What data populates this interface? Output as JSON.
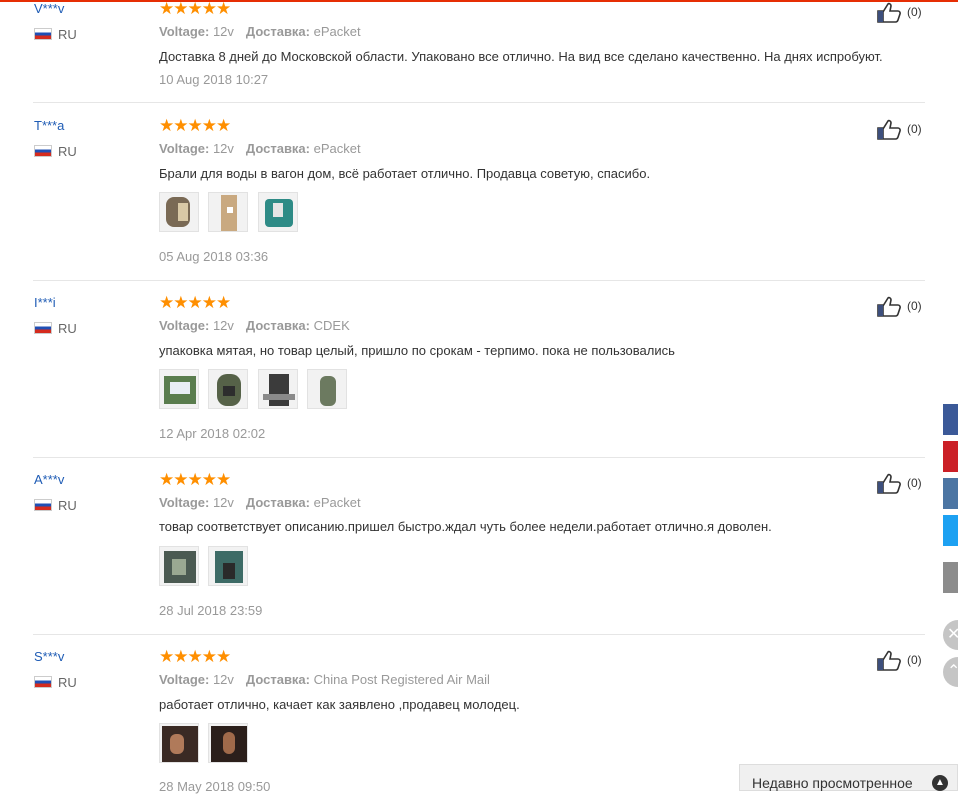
{
  "labels": {
    "voltage": "Voltage:",
    "delivery": "Доставка:",
    "country": "RU"
  },
  "reviews": [
    {
      "user": "V***v",
      "country": "RU",
      "voltage": "12v",
      "delivery": "ePacket",
      "text": "Доставка 8 дней до Московской области. Упаковано все отлично. На вид все сделано качественно. На днях испробуют.",
      "date": "10 Aug 2018 10:27",
      "likes": "(0)",
      "rating": 5
    },
    {
      "user": "T***a",
      "country": "RU",
      "voltage": "12v",
      "delivery": "ePacket",
      "text": "Брали для воды в вагон дом, всё работает отлично. Продавца советую, спасибо.",
      "date": "05 Aug 2018 03:36",
      "likes": "(0)",
      "rating": 5
    },
    {
      "user": "I***i",
      "country": "RU",
      "voltage": "12v",
      "delivery": "CDEK",
      "text": "упаковка мятая, но товар целый, пришло по срокам - терпимо. пока не пользовались",
      "date": "12 Apr 2018 02:02",
      "likes": "(0)",
      "rating": 5
    },
    {
      "user": "A***v",
      "country": "RU",
      "voltage": "12v",
      "delivery": "ePacket",
      "text": "товар соответствует описанию.пришел быстро.ждал чуть более недели.работает отлично.я доволен.",
      "date": "28 Jul 2018 23:59",
      "likes": "(0)",
      "rating": 5
    },
    {
      "user": "S***v",
      "country": "RU",
      "voltage": "12v",
      "delivery": "China Post Registered Air Mail",
      "text": "работает отлично, качает как заявлено ,продавец молодец.",
      "date": "28 May 2018 09:50",
      "likes": "(0)",
      "rating": 5
    }
  ],
  "stars": "★★★★★",
  "recently_viewed": {
    "label": "Недавно просмотренное"
  },
  "share_icons": [
    "facebook-icon",
    "pinterest-icon",
    "vk-icon",
    "twitter-icon",
    "more-icon"
  ],
  "colors": {
    "accent": "#e62e04",
    "star": "#ff8f00",
    "link": "#1f5cb5"
  }
}
